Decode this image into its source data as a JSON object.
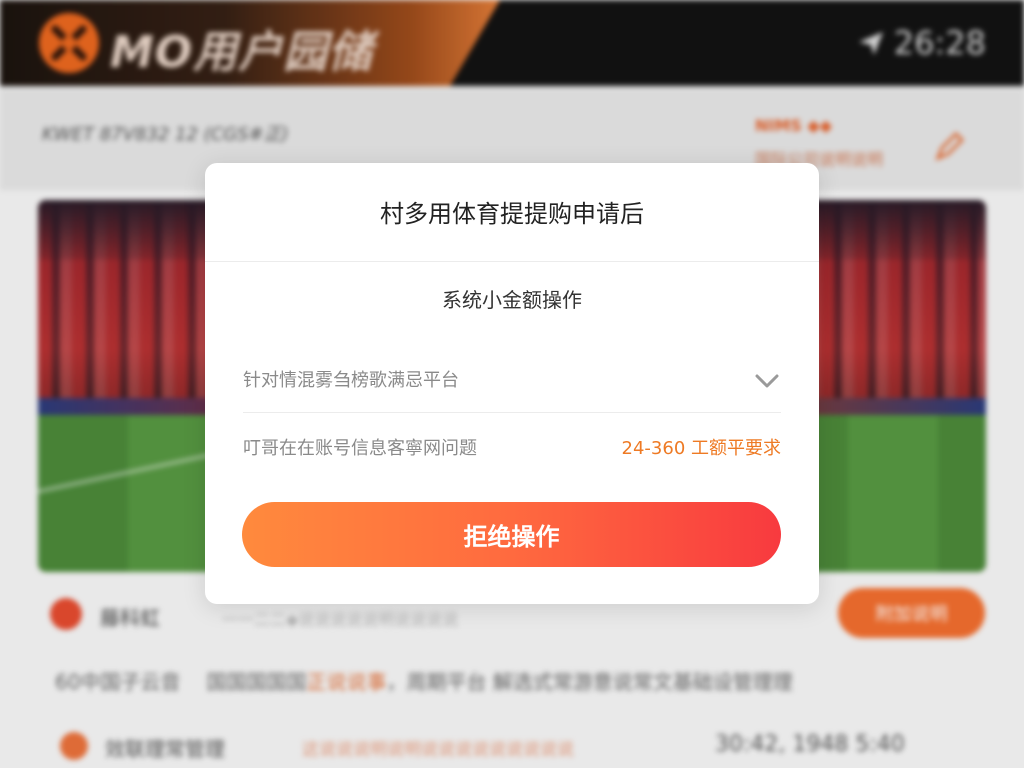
{
  "header": {
    "logo_text": "MO用户园储",
    "time": "26:28"
  },
  "subheader": {
    "left_text": "KWET 87V832 12 (CGS#正)",
    "right_title": "NIMS ◆◆",
    "right_subtitle": "国际公司说明说明"
  },
  "row1": {
    "title": "藤科虹",
    "desc": "一一二二◆说说说说说明说说说说",
    "button_label": "附加说明"
  },
  "row2": {
    "part1": "60中国子云音",
    "part2": "国国国国国",
    "highlight": "正说说事",
    "part3": "，周期平台 解选式常游意说常文基础设管理理"
  },
  "row3": {
    "title": "效联理常管理",
    "desc": "这说说说明说明说说说说说说说说说",
    "right": "30:42, 1948 5:40"
  },
  "modal": {
    "title": "村多用体育提提购申请后",
    "subtitle": "系统小金额操作",
    "select_value": "针对情混雾刍榜歌满忌平台",
    "info_left": "叮哥在在账号信息客寧网问题",
    "info_right": "24-360 工额平要求",
    "button_label": "拒绝操作"
  },
  "colors": {
    "accent": "#ee7a24",
    "button_gradient_start": "#ff8a3d",
    "button_gradient_end": "#f83a3f",
    "header_bg": "#121212"
  }
}
